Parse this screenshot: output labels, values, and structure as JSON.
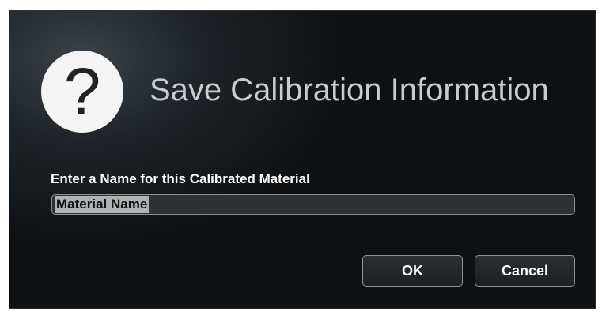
{
  "dialog": {
    "title": "Save Calibration Information",
    "icon": "question-mark-icon",
    "icon_glyph": "?",
    "prompt_label": "Enter a Name for this Calibrated Material",
    "name_input": {
      "value": "Material Name",
      "selected": true
    },
    "buttons": {
      "ok_label": "OK",
      "cancel_label": "Cancel"
    }
  },
  "colors": {
    "dialog_background": "#1d2328",
    "title_text": "#c9ccce",
    "label_text": "#ffffff",
    "input_background": "#2d3237",
    "selection_highlight": "#aeb2b5"
  }
}
